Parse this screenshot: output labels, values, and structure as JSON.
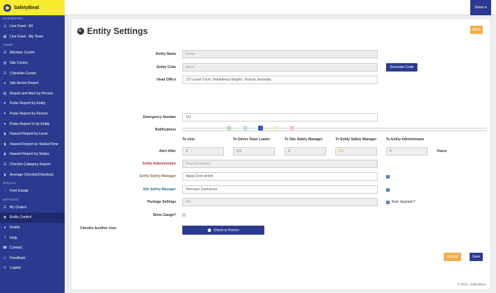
{
  "brand": {
    "name": "SafetyBeat"
  },
  "topbar": {
    "user_label": "Demo ▾"
  },
  "sidebar": {
    "sections": [
      {
        "title": "Dashboard",
        "items": [
          {
            "label": "Live Feed - All",
            "icon": "history-icon"
          },
          {
            "label": "Live Feed - My Team",
            "icon": "calendar-icon"
          }
        ]
      },
      {
        "title": "Admin",
        "items": [
          {
            "label": "Member Centre",
            "icon": "list-icon"
          },
          {
            "label": "Site Centre",
            "icon": "building-icon"
          },
          {
            "label": "Checklist Centre",
            "icon": "checklist-icon"
          },
          {
            "label": "Site Action Report",
            "icon": "map-pin-icon"
          },
          {
            "label": "Report and Alert by Person",
            "icon": "report-icon"
          },
          {
            "label": "Pulse Report by Entity",
            "icon": "pulse-icon"
          },
          {
            "label": "Pulse Report by Person",
            "icon": "pulse-icon"
          },
          {
            "label": "Pulse Report % by Entity",
            "icon": "pulse-icon"
          },
          {
            "label": "Hazard Report by Level",
            "icon": "chart-icon"
          },
          {
            "label": "Hazard Report by Status/Time",
            "icon": "chart-icon"
          },
          {
            "label": "Hazard Report by Status",
            "icon": "chart-icon"
          },
          {
            "label": "Checkin Category Report",
            "icon": "list-icon"
          },
          {
            "label": "Average Checkin/Checkout",
            "icon": "chart-icon"
          }
        ]
      },
      {
        "title": "Special",
        "items": [
          {
            "label": "Fuel Gauge",
            "icon": "gauge-icon"
          }
        ]
      },
      {
        "title": "Settings",
        "items": [
          {
            "label": "My Orders",
            "icon": "list-icon"
          },
          {
            "label": "Entity Control",
            "icon": "globe-icon",
            "active": true
          },
          {
            "label": "Profile",
            "icon": "user-icon"
          },
          {
            "label": "Help",
            "icon": "help-icon"
          },
          {
            "label": "Contact",
            "icon": "phone-icon"
          },
          {
            "label": "Feedback",
            "icon": "comment-icon"
          },
          {
            "label": "Logout",
            "icon": "power-icon"
          }
        ]
      }
    ]
  },
  "page": {
    "title": "Entity Settings",
    "back_label": "Back",
    "generate_code_label": "Generate Code",
    "checkin_button_label": "Check-in Person",
    "cancel_label": "Cancel",
    "save_label": "Save",
    "footer": "© 2015 - SafetyBeat"
  },
  "form": {
    "entity_name": {
      "label": "Entity Name",
      "value": "Demo"
    },
    "entity_code": {
      "label": "Entity Code",
      "value": "demo"
    },
    "head_office": {
      "label": "Head Office",
      "value": "1/3 Laurel Court, Heidelberg Heights, Victoria, Australia"
    },
    "emergency_number": {
      "label": "Emergency Number",
      "value": "111"
    },
    "notifications": {
      "label": "Notifications"
    },
    "alert_after": {
      "label": "Alert After",
      "columns": [
        "To User",
        "To Direct Team Leader",
        "To Site Safety Manager",
        "To Entity Safety Manager",
        "To Entity Administrator"
      ],
      "values": [
        "2",
        "2.5",
        "3",
        "3.5",
        "4"
      ],
      "unit": "Hours"
    },
    "entity_administrator": {
      "label": "Entity Administrator",
      "value": "Paul Goncalves"
    },
    "entity_safety_manager": {
      "label": "Entity Safety Manager",
      "value": "Appja Dont delete"
    },
    "site_safety_manager": {
      "label": "Site Safety Manager",
      "value": "Henrique Goncalves"
    },
    "package_settings": {
      "label": "Package Settings",
      "value": "Pro",
      "auto_upgrade_label": "Auto Upgrade?"
    },
    "show_gauge": {
      "label": "Show Gauge?"
    },
    "checkin_another": {
      "label": "Checkin Another User"
    }
  },
  "colors": {
    "sidebar": "#2b3a8f",
    "brand_yellow": "#f7ec2f",
    "accent_orange": "#f0ad4e",
    "notif_dots": [
      "#b8e0b8",
      "#b8dff0",
      "#2b5fb0",
      "#f3f0c0",
      "#f3c6cf"
    ]
  }
}
